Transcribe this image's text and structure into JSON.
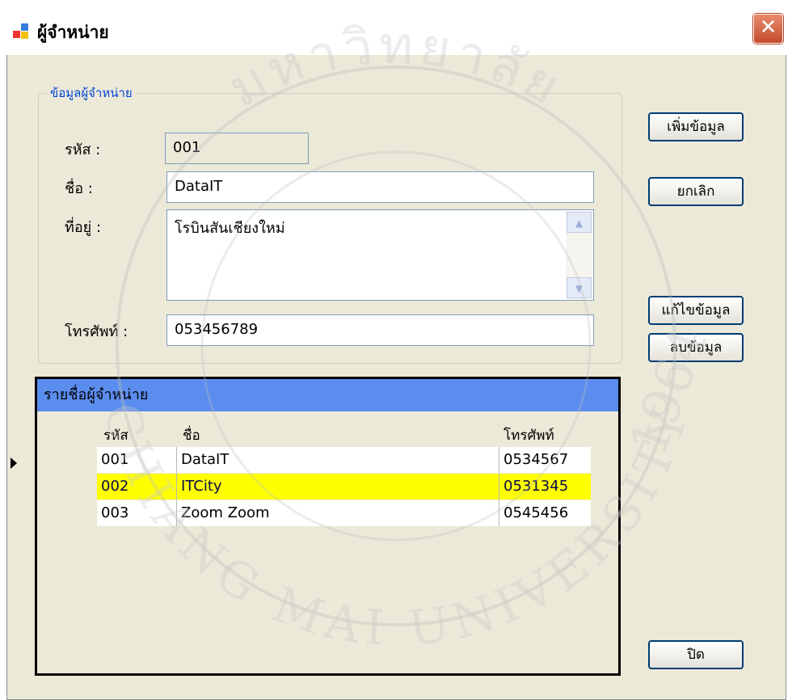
{
  "window": {
    "title": "ผู้จำหน่าย",
    "close_glyph": "✕"
  },
  "form": {
    "group_title": "ข้อมูลผู้จำหน่าย",
    "code_label": "รหัส :",
    "code_value": "001",
    "name_label": "ชื่อ :",
    "name_value": "DataIT",
    "address_label": "ที่อยู่ :",
    "address_value": "โรบินสันเชียงใหม่",
    "phone_label": "โทรศัพท์ :",
    "phone_value": "053456789"
  },
  "buttons": {
    "add": "เพิ่มข้อมูล",
    "cancel": "ยกเลิก",
    "edit": "แก้ไขข้อมูล",
    "delete": "ลบข้อมูล",
    "close": "ปิด"
  },
  "grid": {
    "caption": "รายชื่อผู้จำหน่าย",
    "headers": {
      "code": "รหัส",
      "name": "ชื่อ",
      "phone": "โทรศัพท์"
    },
    "rows": [
      {
        "code": "001",
        "name": "DataIT",
        "phone": "0534567"
      },
      {
        "code": "002",
        "name": "ITCity",
        "phone": "0531345"
      },
      {
        "code": "003",
        "name": "Zoom Zoom",
        "phone": "0545456"
      }
    ],
    "current_row": 1,
    "selected_row": 2
  },
  "watermark": {
    "top": "มหาวิทยาลัย",
    "year": "1964",
    "bottom": "CHIANG MAI UNIVERSITY"
  },
  "colors": {
    "window_bg": "#ece9d8",
    "grid_caption": "#5b8def",
    "selection": "#ffff00",
    "group_title": "#0046d5"
  },
  "icons": {
    "app": "form-window-icon",
    "close": "close-icon",
    "row_pointer": "row-pointer-icon"
  }
}
